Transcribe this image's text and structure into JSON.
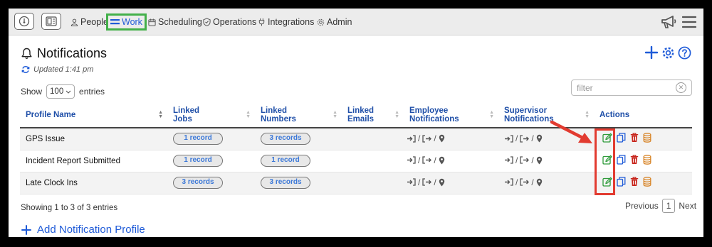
{
  "nav": {
    "people": "People",
    "work": "Work",
    "scheduling": "Scheduling",
    "operations": "Operations",
    "integrations": "Integrations",
    "admin": "Admin"
  },
  "page": {
    "title": "Notifications",
    "updated": "Updated 1:41 pm"
  },
  "length": {
    "show": "Show",
    "value": "100",
    "entries": "entries"
  },
  "filter": {
    "placeholder": "filter"
  },
  "table": {
    "headers": {
      "profile": "Profile Name",
      "jobs": [
        "Linked",
        "Jobs"
      ],
      "numbers": [
        "Linked",
        "Numbers"
      ],
      "emails": [
        "Linked",
        "Emails"
      ],
      "employee": [
        "Employee",
        "Notifications"
      ],
      "supervisor": [
        "Supervisor",
        "Notifications"
      ],
      "actions": "Actions"
    },
    "rows": [
      {
        "name": "GPS Issue",
        "jobs": "1 record",
        "numbers": "3 records"
      },
      {
        "name": "Incident Report Submitted",
        "jobs": "1 record",
        "numbers": "1 record"
      },
      {
        "name": "Late Clock Ins",
        "jobs": "3 records",
        "numbers": "3 records"
      }
    ]
  },
  "footer": {
    "showing": "Showing 1 to 3 of 3 entries",
    "previous": "Previous",
    "page": "1",
    "next": "Next"
  },
  "add_profile": "Add Notification Profile",
  "colors": {
    "accent": "#1f5bd8",
    "highlight_green": "#43b04a",
    "highlight_red": "#e23b30",
    "edit": "#2e9b3a",
    "delete": "#c8271e",
    "database": "#d8862a"
  }
}
